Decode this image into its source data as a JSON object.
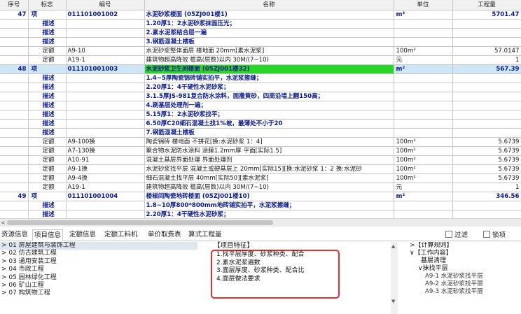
{
  "grid": {
    "columns": [
      "序号",
      "标志",
      "编号",
      "名称",
      "单位",
      "工程量"
    ],
    "rows": [
      {
        "kind": "xiang",
        "seq": "47",
        "type": "项",
        "code": "011101001002",
        "name": "水泥砂浆楼面 (05ZJ001楼1)",
        "unit": "m²",
        "qty": "5701.47"
      },
      {
        "kind": "miaoshu",
        "seq": "",
        "type": "描述",
        "code": "",
        "name": "1.20厚1：2水泥砂浆抹面压光；",
        "unit": "",
        "qty": ""
      },
      {
        "kind": "miaoshu",
        "seq": "",
        "type": "描述",
        "code": "",
        "name": "2.素水泥浆结合层一遍",
        "unit": "",
        "qty": ""
      },
      {
        "kind": "miaoshu",
        "seq": "",
        "type": "描述",
        "code": "",
        "name": "3.钢筋混凝土楼板",
        "unit": "",
        "qty": ""
      },
      {
        "kind": "dinge",
        "seq": "",
        "type": "定额",
        "code": "A9-10",
        "name": "水泥砂浆整体面层 楼地面 20mm[素水泥浆]",
        "unit": "100m²",
        "qty": "57.0147"
      },
      {
        "kind": "dinge",
        "seq": "",
        "type": "定额",
        "code": "A19-1",
        "name": "建筑物超高降效 檐高(层数)以内 30M/(7~10)",
        "unit": "元",
        "qty": "1"
      },
      {
        "kind": "xiang",
        "seq": "48",
        "type": "项",
        "code": "011101001003",
        "name": "水泥砂浆卫生间楼面 (05ZJ001楼32)",
        "unit": "m²",
        "qty": "567.39",
        "selected": true
      },
      {
        "kind": "miaoshu",
        "seq": "",
        "type": "描述",
        "code": "",
        "name": "1.4~5厚陶瓷锦砖铺实拍平，水泥浆擦缝；",
        "unit": "",
        "qty": ""
      },
      {
        "kind": "miaoshu",
        "seq": "",
        "type": "描述",
        "code": "",
        "name": "2.20厚1：4干硬性水泥砂浆；",
        "unit": "",
        "qty": ""
      },
      {
        "kind": "miaoshu",
        "seq": "",
        "type": "描述",
        "code": "",
        "name": "3.1.5厚JS-981复合防水涂料，面撒黄砂，四周沿墙上翻150高；",
        "unit": "",
        "qty": ""
      },
      {
        "kind": "miaoshu",
        "seq": "",
        "type": "描述",
        "code": "",
        "name": "4.刷基层处理剂一遍；",
        "unit": "",
        "qty": ""
      },
      {
        "kind": "miaoshu",
        "seq": "",
        "type": "描述",
        "code": "",
        "name": "5.15厚1：2水泥砂浆找平；",
        "unit": "",
        "qty": ""
      },
      {
        "kind": "miaoshu",
        "seq": "",
        "type": "描述",
        "code": "",
        "name": "6.50厚C20细石混凝土找1%坡，最薄处不小于20",
        "unit": "",
        "qty": ""
      },
      {
        "kind": "miaoshu",
        "seq": "",
        "type": "描述",
        "code": "",
        "name": "7.钢筋混凝土楼板",
        "unit": "",
        "qty": ""
      },
      {
        "kind": "dinge",
        "seq": "",
        "type": "定额",
        "code": "A9-100换",
        "name": "陶瓷锦砖 楼地面 不拼花[换:水泥砂浆 1：4]",
        "unit": "100m²",
        "qty": "5.6739"
      },
      {
        "kind": "dinge",
        "seq": "",
        "type": "定额",
        "code": "A7-130换",
        "name": "聚合物水泥防水涂料 涂膜1.2mm厚 平面[实际1.5]",
        "unit": "100m²",
        "qty": "5.6739"
      },
      {
        "kind": "dinge",
        "seq": "",
        "type": "定额",
        "code": "A10-91",
        "name": "混凝土基层界面处理 界面处理剂",
        "unit": "100m²",
        "qty": "5.6739"
      },
      {
        "kind": "dinge",
        "seq": "",
        "type": "定额",
        "code": "A9-1换",
        "name": "水泥砂浆找平层 混凝土或硬基层上 20mm[实际15][换:水泥砂浆 1：2 换:水泥砂",
        "unit": "100m²",
        "qty": "5.6739"
      },
      {
        "kind": "dinge",
        "seq": "",
        "type": "定额",
        "code": "A9-4换",
        "name": "细石混凝土找平层 40mm[实际50][素水泥浆]",
        "unit": "100m²",
        "qty": "5.6739"
      },
      {
        "kind": "dinge",
        "seq": "",
        "type": "定额",
        "code": "A19-1",
        "name": "建筑物超高降效 檐高(层数)以内 30M/(7~10)",
        "unit": "元",
        "qty": "1"
      },
      {
        "kind": "xiang",
        "seq": "49",
        "type": "项",
        "code": "011101001004",
        "name": "楼梯间陶瓷地砖楼面 (05ZJ001楼10)",
        "unit": "m²",
        "qty": "346.56"
      },
      {
        "kind": "miaoshu",
        "seq": "",
        "type": "描述",
        "code": "",
        "name": "1.8~10厚800*800mm地砖铺实拍平，水泥浆擦缝；",
        "unit": "",
        "qty": ""
      },
      {
        "kind": "miaoshu",
        "seq": "",
        "type": "描述",
        "code": "",
        "name": "2.20厚1：4干硬性水泥砂浆；",
        "unit": "",
        "qty": ""
      }
    ]
  },
  "hscroll_left": "<",
  "tabs": [
    {
      "label": "资源信息",
      "active": false
    },
    {
      "label": "项目信息",
      "active": true
    },
    {
      "label": "定额信息",
      "active": false
    },
    {
      "label": "定额工料机",
      "active": false
    },
    {
      "label": "单价取费表",
      "active": false
    },
    {
      "label": "算式工程量",
      "active": false
    }
  ],
  "filters": {
    "filter_label": "过滤",
    "lock_label": "锁项"
  },
  "tree": [
    {
      "label": "> 01 房屋建筑与装饰工程",
      "selected": true
    },
    {
      "label": "> 02 仿古建筑工程"
    },
    {
      "label": "> 03 通用安装工程"
    },
    {
      "label": "> 04 市政工程"
    },
    {
      "label": "> 05 园林绿化工程"
    },
    {
      "label": "> 06 矿山工程"
    },
    {
      "label": "> 07 构筑物工程"
    }
  ],
  "features": {
    "title": "【项目特征】",
    "items": [
      "1.找平层厚度、砂浆种类、配合",
      "2.素水泥浆遍数",
      "3.面层厚度、砂浆种类、配合比",
      "4.面层做法要求"
    ]
  },
  "rules": {
    "lines": [
      {
        "text": ">【计算规则】",
        "indent": 10
      },
      {
        "text": "∨【工作内容】",
        "indent": 10
      },
      {
        "text": "基层清理",
        "indent": 26
      },
      {
        "text": "∨抹找平层",
        "indent": 22
      },
      {
        "text": "A9-1 水泥砂浆找平层",
        "indent": 32,
        "sub": true
      },
      {
        "text": "A9-2 水泥砂浆找平层",
        "indent": 32,
        "sub": true
      },
      {
        "text": "A9-3 水泥砂浆找平层",
        "indent": 32,
        "sub": true
      }
    ]
  }
}
